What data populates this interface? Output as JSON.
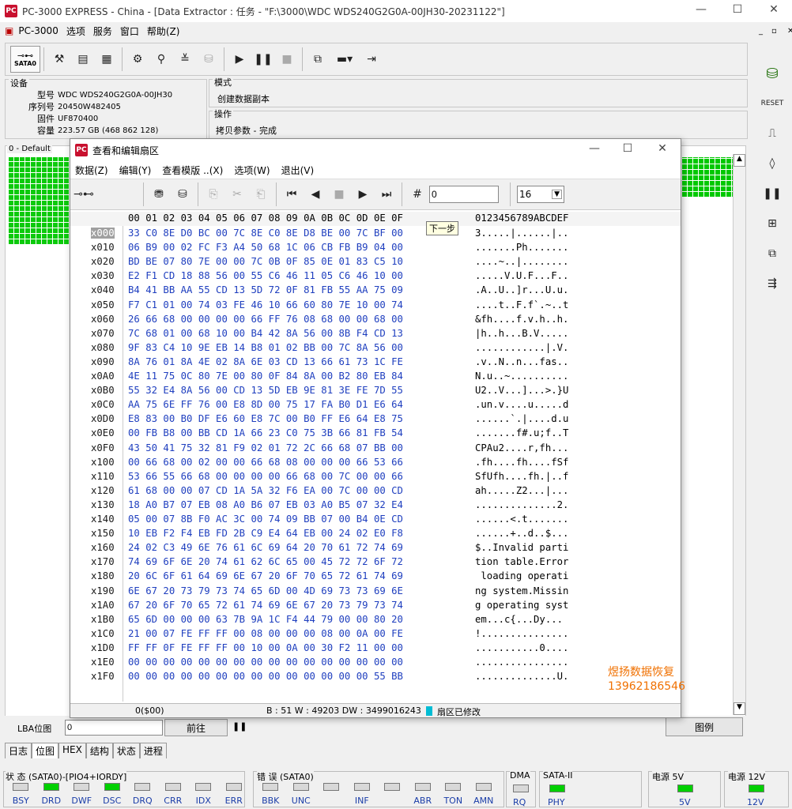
{
  "app": {
    "logo": "PC",
    "title": "PC-3000 EXPRESS - China - [Data Extractor : 任务 - \"F:\\3000\\WDC WDS240G2G0A-00JH30-20231122\"]"
  },
  "menu": {
    "items": [
      "PC-3000",
      "选项",
      "服务",
      "窗口",
      "帮助(Z)"
    ]
  },
  "toolbar": {
    "sata_label": "SATA0"
  },
  "device": {
    "section": "设备",
    "model_label": "型号",
    "model": "WDC WDS240G2G0A-00JH30",
    "serial_label": "序列号",
    "serial": "20450W482405",
    "fw_label": "固件",
    "fw": "UF870400",
    "cap_label": "容量",
    "cap": "223.57 GB (468 862 128)"
  },
  "mode": {
    "section": "模式",
    "value": "创建数据副本"
  },
  "operation": {
    "section": "操作",
    "value": "拷贝参数 - 完成"
  },
  "map_panel": {
    "label": "0 - Default"
  },
  "hex": {
    "title": "查看和编辑扇区",
    "menu": [
      "数据(Z)",
      "编辑(Y)",
      "查看模版 ..(X)",
      "选项(W)",
      "退出(V)"
    ],
    "sector_input": "0",
    "rows_input": "16",
    "tooltip": "下一步",
    "header_hex": "00 01 02 03 04 05 06 07 08 09 0A 0B 0C 0D 0E 0F",
    "header_ascii": "0123456789ABCDEF",
    "rows": [
      [
        "x000",
        "33 C0 8E D0 BC 00 7C 8E C0 8E D8 BE 00 7C BF 00",
        "3.....|......|.."
      ],
      [
        "x010",
        "06 B9 00 02 FC F3 A4 50 68 1C 06 CB FB B9 04 00",
        ".......Ph......."
      ],
      [
        "x020",
        "BD BE 07 80 7E 00 00 7C 0B 0F 85 0E 01 83 C5 10",
        "....~..|........"
      ],
      [
        "x030",
        "E2 F1 CD 18 88 56 00 55 C6 46 11 05 C6 46 10 00",
        ".....V.U.F...F.."
      ],
      [
        "x040",
        "B4 41 BB AA 55 CD 13 5D 72 0F 81 FB 55 AA 75 09",
        ".A..U..]r...U.u."
      ],
      [
        "x050",
        "F7 C1 01 00 74 03 FE 46 10 66 60 80 7E 10 00 74",
        "....t..F.f`.~..t"
      ],
      [
        "x060",
        "26 66 68 00 00 00 00 66 FF 76 08 68 00 00 68 00",
        "&fh....f.v.h..h."
      ],
      [
        "x070",
        "7C 68 01 00 68 10 00 B4 42 8A 56 00 8B F4 CD 13",
        "|h..h...B.V....."
      ],
      [
        "x080",
        "9F 83 C4 10 9E EB 14 B8 01 02 BB 00 7C 8A 56 00",
        "............|.V."
      ],
      [
        "x090",
        "8A 76 01 8A 4E 02 8A 6E 03 CD 13 66 61 73 1C FE",
        ".v..N..n...fas.."
      ],
      [
        "x0A0",
        "4E 11 75 0C 80 7E 00 80 0F 84 8A 00 B2 80 EB 84",
        "N.u..~.........."
      ],
      [
        "x0B0",
        "55 32 E4 8A 56 00 CD 13 5D EB 9E 81 3E FE 7D 55",
        "U2..V...]...>.}U"
      ],
      [
        "x0C0",
        "AA 75 6E FF 76 00 E8 8D 00 75 17 FA B0 D1 E6 64",
        ".un.v....u.....d"
      ],
      [
        "x0D0",
        "E8 83 00 B0 DF E6 60 E8 7C 00 B0 FF E6 64 E8 75",
        "......`.|....d.u"
      ],
      [
        "x0E0",
        "00 FB B8 00 BB CD 1A 66 23 C0 75 3B 66 81 FB 54",
        ".......f#.u;f..T"
      ],
      [
        "x0F0",
        "43 50 41 75 32 81 F9 02 01 72 2C 66 68 07 BB 00",
        "CPAu2....r,fh..."
      ],
      [
        "x100",
        "00 66 68 00 02 00 00 66 68 08 00 00 00 66 53 66",
        ".fh....fh....fSf"
      ],
      [
        "x110",
        "53 66 55 66 68 00 00 00 00 66 68 00 7C 00 00 66",
        "SfUfh....fh.|..f"
      ],
      [
        "x120",
        "61 68 00 00 07 CD 1A 5A 32 F6 EA 00 7C 00 00 CD",
        "ah.....Z2...|..."
      ],
      [
        "x130",
        "18 A0 B7 07 EB 08 A0 B6 07 EB 03 A0 B5 07 32 E4",
        "..............2."
      ],
      [
        "x140",
        "05 00 07 8B F0 AC 3C 00 74 09 BB 07 00 B4 0E CD",
        "......<.t......."
      ],
      [
        "x150",
        "10 EB F2 F4 EB FD 2B C9 E4 64 EB 00 24 02 E0 F8",
        "......+..d..$..."
      ],
      [
        "x160",
        "24 02 C3 49 6E 76 61 6C 69 64 20 70 61 72 74 69",
        "$..Invalid parti"
      ],
      [
        "x170",
        "74 69 6F 6E 20 74 61 62 6C 65 00 45 72 72 6F 72",
        "tion table.Error"
      ],
      [
        "x180",
        "20 6C 6F 61 64 69 6E 67 20 6F 70 65 72 61 74 69",
        " loading operati"
      ],
      [
        "x190",
        "6E 67 20 73 79 73 74 65 6D 00 4D 69 73 73 69 6E",
        "ng system.Missin"
      ],
      [
        "x1A0",
        "67 20 6F 70 65 72 61 74 69 6E 67 20 73 79 73 74",
        "g operating syst"
      ],
      [
        "x1B0",
        "65 6D 00 00 00 63 7B 9A 1C F4 44 79 00 00 80 20",
        "em...c{...Dy... "
      ],
      [
        "x1C0",
        "21 00 07 FE FF FF 00 08 00 00 00 08 00 0A 00 FE",
        "!..............."
      ],
      [
        "x1D0",
        "FF FF 0F FE FF FF 00 10 00 0A 00 30 F2 11 00 00",
        "...........0...."
      ],
      [
        "x1E0",
        "00 00 00 00 00 00 00 00 00 00 00 00 00 00 00 00",
        "................"
      ],
      [
        "x1F0",
        "00 00 00 00 00 00 00 00 00 00 00 00 00 00 55 BB",
        "..............U."
      ]
    ],
    "status_offset": "0($00)",
    "status_info": "B : 51 W : 49203 DW : 3499016243",
    "status_modified": "扇区已修改",
    "watermark_1": "煜扬数据恢复",
    "watermark_2": "13962186546"
  },
  "lba": {
    "label": "LBA位图",
    "value": "0",
    "goto": "前往",
    "legend": "图例"
  },
  "tabs": [
    "日志",
    "位图",
    "HEX",
    "结构",
    "状态",
    "进程"
  ],
  "status": {
    "state_label": "状 态 (SATA0)-[PIO4+IORDY]",
    "state_leds": [
      {
        "n": "BSY",
        "on": false
      },
      {
        "n": "DRD",
        "on": true
      },
      {
        "n": "DWF",
        "on": false
      },
      {
        "n": "DSC",
        "on": true
      },
      {
        "n": "DRQ",
        "on": false
      },
      {
        "n": "CRR",
        "on": false
      },
      {
        "n": "IDX",
        "on": false
      },
      {
        "n": "ERR",
        "on": false
      }
    ],
    "error_label": "错 误 (SATA0)",
    "error_leds": [
      {
        "n": "BBK",
        "on": false
      },
      {
        "n": "UNC",
        "on": false
      },
      {
        "n": "",
        "on": false
      },
      {
        "n": "INF",
        "on": false
      },
      {
        "n": "",
        "on": false
      },
      {
        "n": "ABR",
        "on": false
      },
      {
        "n": "TON",
        "on": false
      },
      {
        "n": "AMN",
        "on": false
      }
    ],
    "dma_label": "DMA",
    "dma_led": "RQ",
    "sata_label": "SATA-II",
    "sata_led": "PHY",
    "p5_label": "电源 5V",
    "p5_led": "5V",
    "p12_label": "电源 12V",
    "p12_led": "12V"
  }
}
